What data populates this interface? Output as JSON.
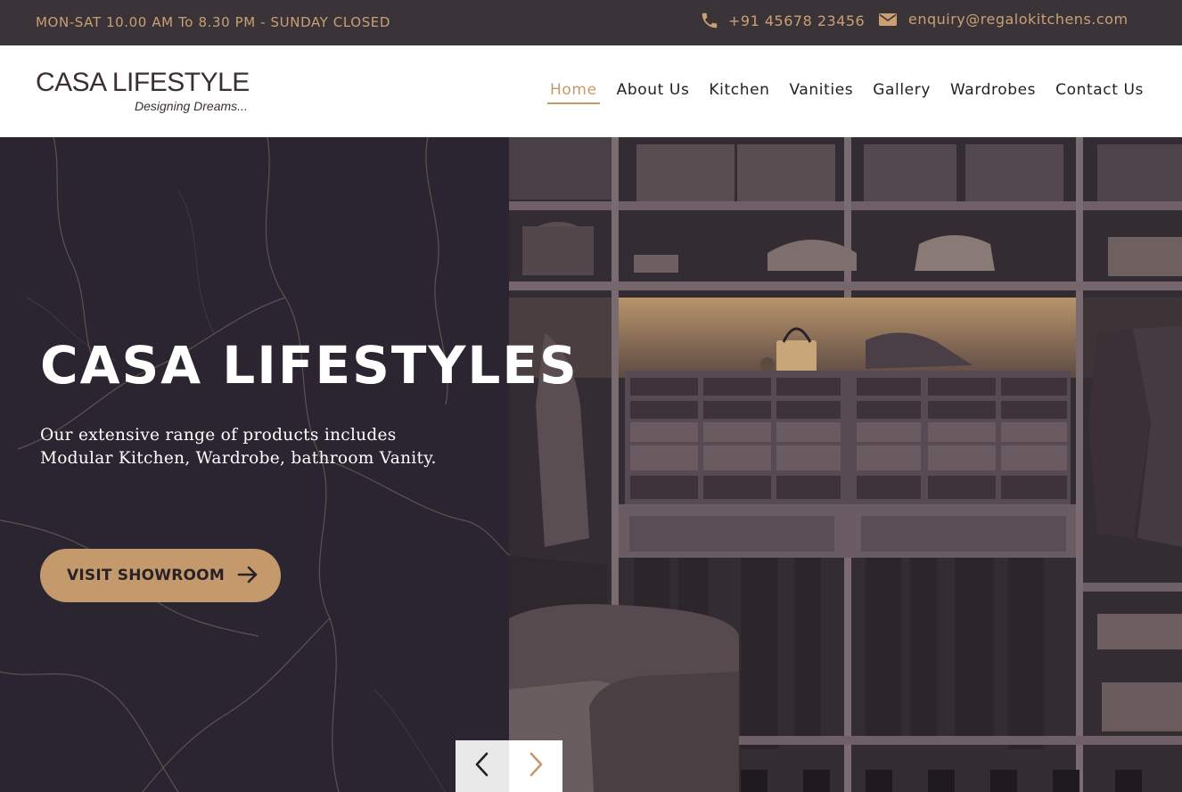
{
  "topbar": {
    "hours": "MON-SAT 10.00 AM To 8.30 PM - SUNDAY CLOSED",
    "phone": "+91 45678 23456",
    "email": "enquiry@regalokitchens.com",
    "phone_icon": "phone-icon",
    "mail_icon": "mail-icon"
  },
  "header": {
    "logo_text": "CASA LIFESTYLE",
    "logo_tagline": "Designing Dreams...",
    "nav": [
      {
        "label": "Home",
        "active": true
      },
      {
        "label": "About Us"
      },
      {
        "label": "Kitchen"
      },
      {
        "label": "Vanities"
      },
      {
        "label": "Gallery"
      },
      {
        "label": "Wardrobes"
      },
      {
        "label": "Contact Us"
      }
    ]
  },
  "hero": {
    "title": "CASA LIFESTYLES",
    "description": "Our extensive range of products includes Modular Kitchen, Wardrobe, bathroom Vanity.",
    "cta_label": "VISIT SHOWROOM",
    "cta_icon": "arrow-right-icon",
    "prev_icon": "chevron-left-icon",
    "next_icon": "chevron-right-icon"
  },
  "colors": {
    "accent": "#c49a6c",
    "topbar_bg": "#3a3338",
    "hero_bg": "#2a2530",
    "white": "#ffffff"
  }
}
